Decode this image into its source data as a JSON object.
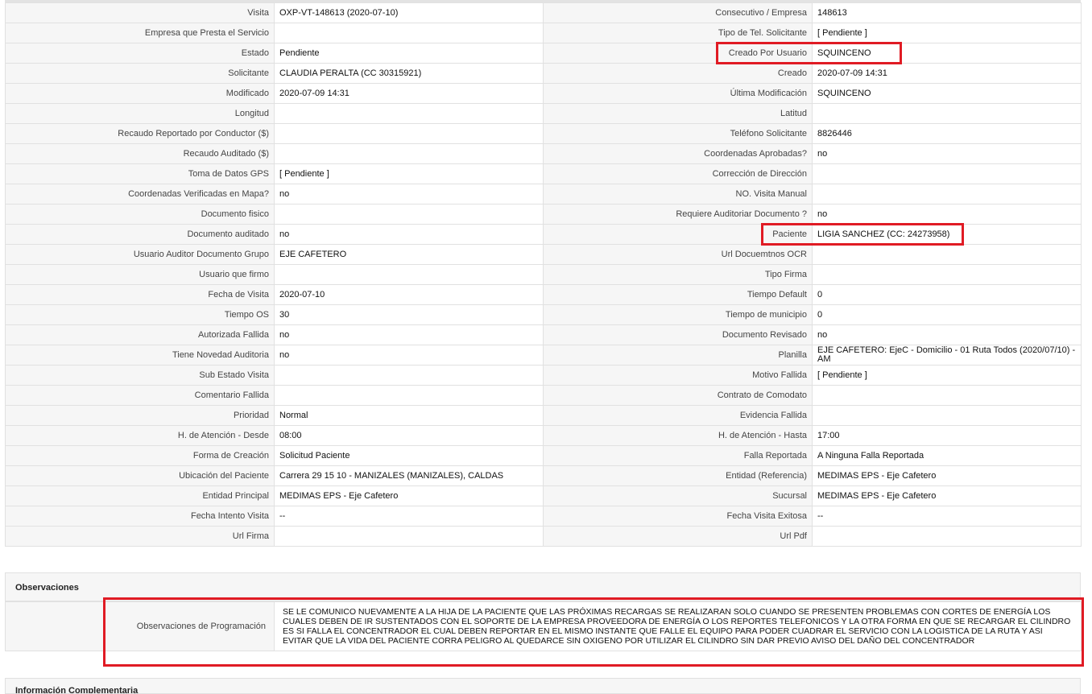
{
  "rows": [
    [
      "Visita",
      "OXP-VT-148613 (2020-07-10)",
      "Consecutivo / Empresa",
      "148613"
    ],
    [
      "Empresa que Presta el Servicio",
      "",
      "Tipo de Tel. Solicitante",
      "[ Pendiente ]"
    ],
    [
      "Estado",
      "Pendiente",
      "Creado Por Usuario",
      "SQUINCENO"
    ],
    [
      "Solicitante",
      "CLAUDIA PERALTA (CC 30315921)",
      "Creado",
      "2020-07-09 14:31"
    ],
    [
      "Modificado",
      "2020-07-09 14:31",
      "Última Modificación",
      " SQUINCENO"
    ],
    [
      "Longitud",
      "",
      "Latitud",
      ""
    ],
    [
      "Recaudo Reportado por Conductor ($)",
      "",
      "Teléfono Solicitante",
      "8826446"
    ],
    [
      "Recaudo Auditado ($)",
      "",
      "Coordenadas Aprobadas?",
      " no"
    ],
    [
      "Toma de Datos GPS",
      "[ Pendiente ]",
      "Corrección de Dirección",
      ""
    ],
    [
      "Coordenadas Verificadas en Mapa?",
      " no",
      "NO. Visita Manual",
      ""
    ],
    [
      "Documento fisico",
      "",
      "Requiere Auditoriar Documento ?",
      " no"
    ],
    [
      "Documento auditado",
      " no",
      "Paciente",
      "LIGIA SANCHEZ (CC: 24273958)"
    ],
    [
      "Usuario Auditor Documento Grupo",
      "EJE CAFETERO",
      "Url Docuemtnos OCR",
      ""
    ],
    [
      "Usuario que firmo",
      "",
      "Tipo Firma",
      ""
    ],
    [
      "Fecha de Visita",
      " 2020-07-10",
      "Tiempo Default",
      "0"
    ],
    [
      "Tiempo OS",
      "30",
      "Tiempo de municipio",
      "0"
    ],
    [
      "Autorizada Fallida",
      " no",
      "Documento Revisado",
      " no"
    ],
    [
      "Tiene Novedad Auditoria",
      " no",
      "Planilla",
      "EJE CAFETERO: EjeC - Domicilio - 01 Ruta Todos (2020/07/10) - AM"
    ],
    [
      "Sub Estado Visita",
      "",
      "Motivo Fallida",
      "[ Pendiente ]"
    ],
    [
      "Comentario Fallida",
      "",
      "Contrato de Comodato",
      ""
    ],
    [
      "Prioridad",
      "Normal",
      "Evidencia Fallida",
      ""
    ],
    [
      "H. de Atención - Desde",
      "08:00",
      "H. de Atención - Hasta",
      "17:00"
    ],
    [
      "Forma de Creación",
      "Solicitud Paciente",
      "Falla Reportada",
      "A Ninguna Falla Reportada"
    ],
    [
      "Ubicación del Paciente",
      "Carrera 29 15 10 - MANIZALES (MANIZALES), CALDAS",
      "Entidad (Referencia)",
      "MEDIMAS EPS - Eje Cafetero"
    ],
    [
      "Entidad Principal",
      "MEDIMAS EPS - Eje Cafetero",
      "Sucursal",
      "MEDIMAS EPS - Eje Cafetero"
    ],
    [
      "Fecha Intento Visita",
      " --",
      "Fecha Visita Exitosa",
      " --"
    ],
    [
      "Url Firma",
      "",
      "Url Pdf",
      ""
    ]
  ],
  "observaciones": {
    "title": "Observaciones",
    "label": "Observaciones de Programación",
    "text": " SE LE COMUNICO NUEVAMENTE A LA HIJA DE LA PACIENTE QUE LAS PRÓXIMAS RECARGAS SE REALIZARAN SOLO CUANDO SE PRESENTEN PROBLEMAS CON CORTES DE ENERGÍA LOS CUALES DEBEN DE IR SUSTENTADOS CON EL SOPORTE DE LA EMPRESA PROVEEDORA DE ENERGÍA O LOS REPORTES TELEFONICOS Y LA OTRA FORMA EN QUE SE RECARGAR EL CILINDRO ES SI FALLA EL CONCENTRADOR EL CUAL DEBEN REPORTAR EN EL MISMO INSTANTE QUE FALLE EL EQUIPO PARA PODER CUADRAR EL SERVICIO CON LA LOGISTICA DE LA RUTA Y ASI EVITAR QUE LA VIDA DEL PACIENTE CORRA PELIGRO AL QUEDARCE SIN OXIGENO POR UTILIZAR EL CILINDRO SIN DAR PREVIO AVISO DEL DAÑO DEL CONCENTRADOR"
  },
  "next_section_title": "Información Complementaria",
  "highlight_color": "#e01b24"
}
